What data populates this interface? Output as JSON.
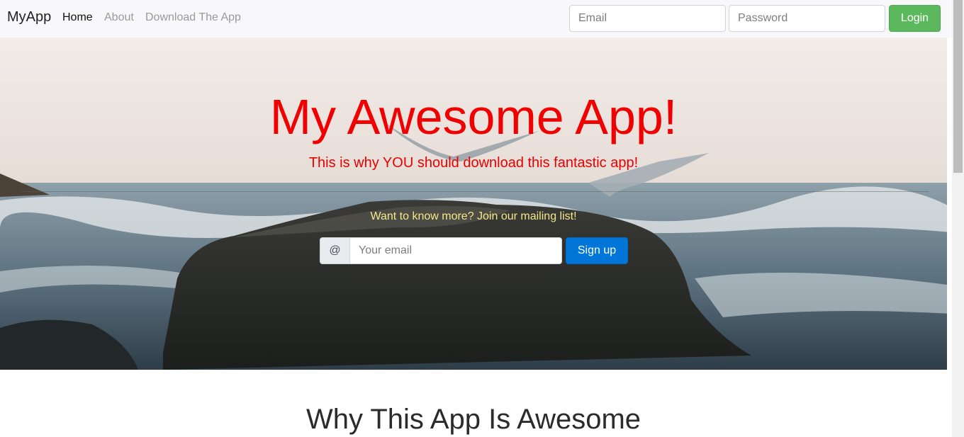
{
  "nav": {
    "brand": "MyApp",
    "links": [
      {
        "label": "Home",
        "active": true
      },
      {
        "label": "About",
        "active": false
      },
      {
        "label": "Download The App",
        "active": false
      }
    ],
    "email_placeholder": "Email",
    "password_placeholder": "Password",
    "login_label": "Login"
  },
  "hero": {
    "title": "My Awesome App!",
    "subtitle": "This is why YOU should download this fantastic app!",
    "cta": "Want to know more? Join our mailing list!",
    "addon": "@",
    "email_placeholder": "Your email",
    "signup_label": "Sign up"
  },
  "section": {
    "title": "Why This App Is Awesome"
  },
  "colors": {
    "login": "#5cb85c",
    "signup": "#0275d8",
    "title": "#f00000",
    "cta": "#f3e88a"
  }
}
